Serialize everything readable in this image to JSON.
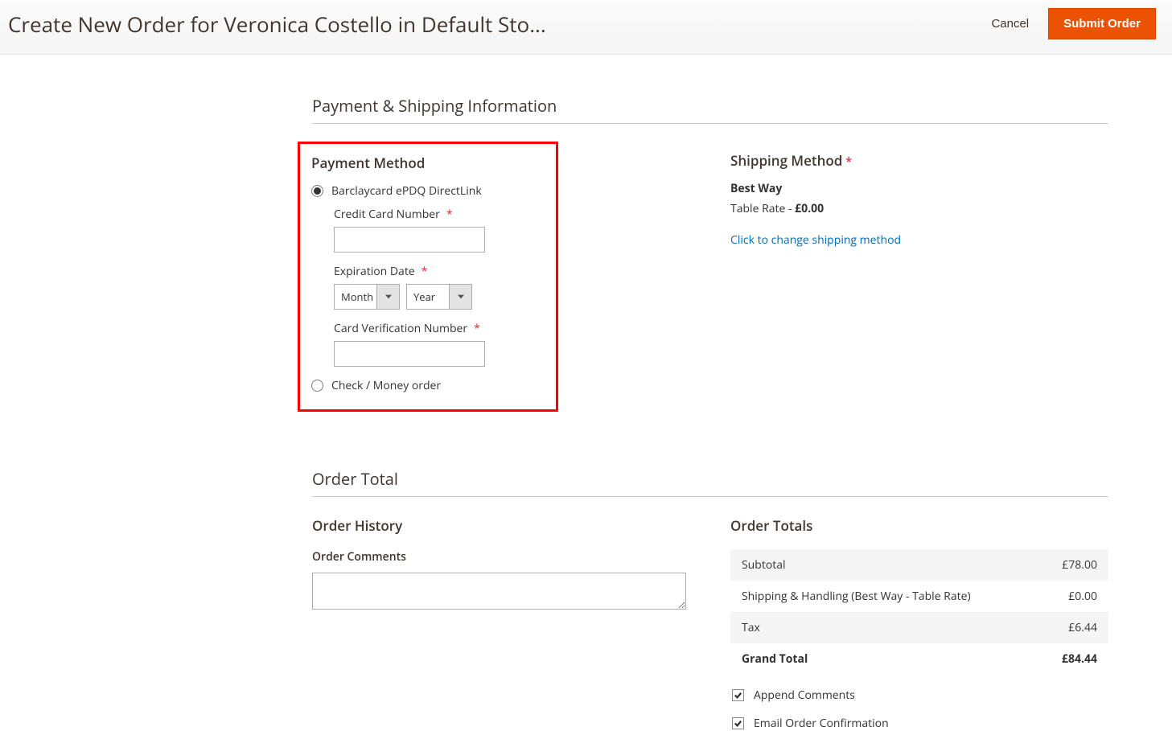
{
  "header": {
    "title": "Create New Order for Veronica Costello in Default Sto...",
    "cancel": "Cancel",
    "submit": "Submit Order"
  },
  "payment_shipping": {
    "heading": "Payment & Shipping Information",
    "payment": {
      "title": "Payment Method",
      "option1": "Barclaycard ePDQ DirectLink",
      "option2": "Check / Money order",
      "cc_label": "Credit Card Number",
      "exp_label": "Expiration Date",
      "month_placeholder": "Month",
      "year_placeholder": "Year",
      "cvv_label": "Card Verification Number"
    },
    "shipping": {
      "title": "Shipping Method",
      "method_name": "Best Way",
      "rate_label": "Table Rate - ",
      "rate_value": "£0.00",
      "change_link": "Click to change shipping method"
    }
  },
  "order_total": {
    "heading": "Order Total",
    "history_title": "Order History",
    "comments_label": "Order Comments",
    "totals_title": "Order Totals",
    "rows": {
      "subtotal_label": "Subtotal",
      "subtotal_value": "£78.00",
      "shipping_label": "Shipping & Handling (Best Way - Table Rate)",
      "shipping_value": "£0.00",
      "tax_label": "Tax",
      "tax_value": "£6.44",
      "grand_label": "Grand Total",
      "grand_value": "£84.44"
    },
    "append_comments": "Append Comments",
    "email_confirmation": "Email Order Confirmation"
  }
}
